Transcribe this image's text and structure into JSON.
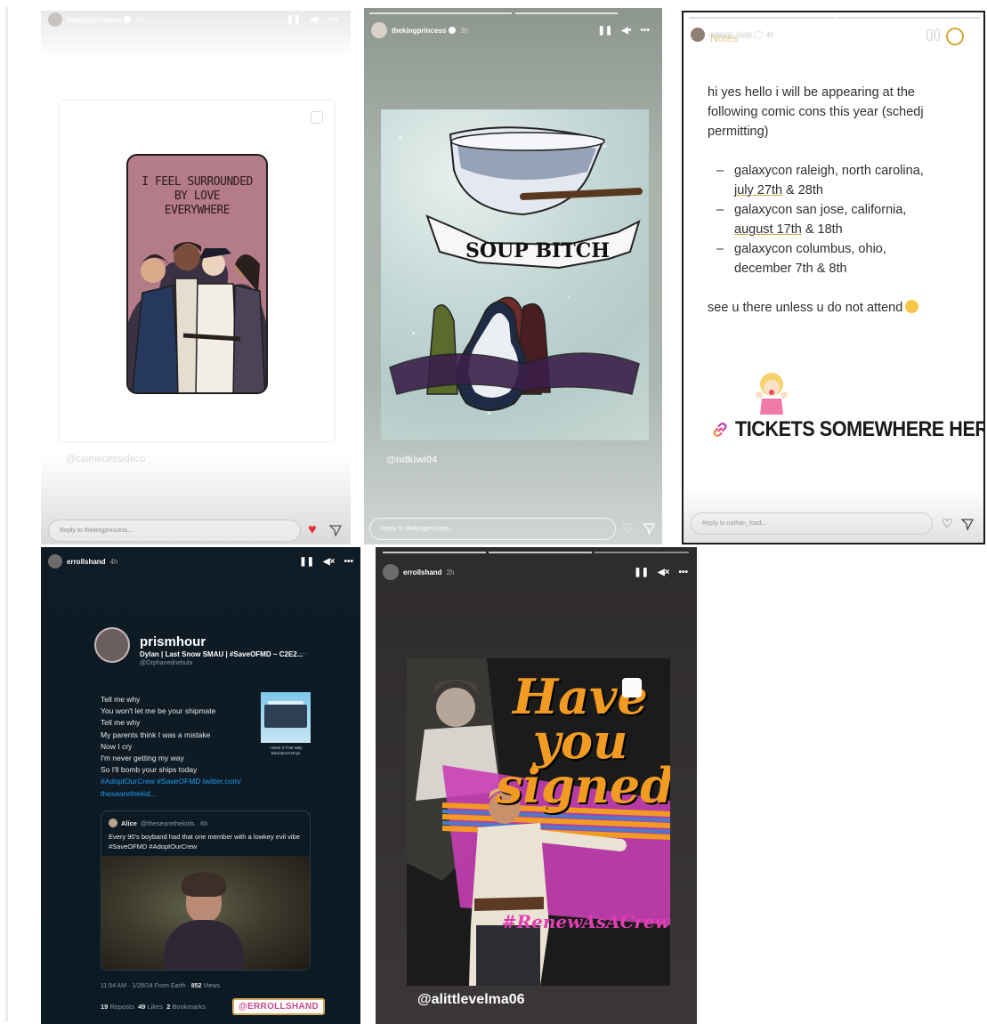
{
  "story1": {
    "user": "thekingprincess",
    "time": "3h",
    "sticker_lines": [
      "I FEEL SURROUNDED",
      "BY LOVE",
      "EVERYWHERE"
    ],
    "watermark": "@caimecessideco",
    "reply_placeholder": "Reply to thekingprincess...",
    "colors": {
      "heart": "#ed2a3c",
      "sticker_bg": "#b47b88"
    }
  },
  "story2": {
    "user": "thekingprincess",
    "time": "3h",
    "banner_text": "SOUP BITCH",
    "handle": "@ndkiwi04",
    "reply_placeholder": "Reply to thekingprincess..."
  },
  "story3": {
    "user": "nathan_foad",
    "time": "4h",
    "notes_title": "Notes",
    "intro": "hi yes hello i will be appearing at the following comic cons this year (schedj permitting)",
    "cons": [
      {
        "place": "galaxycon raleigh, north carolina,",
        "date_u": "july 27th",
        "date_rest": " & 28th"
      },
      {
        "place": "galaxycon san jose, california,",
        "date_u": "august 17th",
        "date_rest": " & 18th"
      },
      {
        "place": "galaxycon columbus, ohio,",
        "date_u": "",
        "date_rest": "december 7th & 8th"
      }
    ],
    "sign_off": "see u there unless u do not attend",
    "link_label": "TICKETS SOMEWHERE HERE",
    "reply_placeholder": "Reply to nathan_foad..."
  },
  "story4": {
    "user": "errollshand",
    "time": "4h",
    "tweet": {
      "display_name": "prismhour",
      "sub_name": "Dylan | Last Snow SMAU | #SaveOFMD ~ C2E2...",
      "at": "@Orphanednebula",
      "more": "···",
      "lyrics": [
        "Tell me why",
        "You won't let me be your shipmate",
        "Tell me why",
        "My parents think I was a mistake",
        "Now I cry",
        "I'm never getting my way",
        "So I'll bomb your ships today"
      ],
      "tags_line1": "#AdoptOurCrew #SaveOFMD twitter.com/",
      "tags_line2": "thesearethekid...",
      "album_caption": "I Want It That Way\nBackstreet Boys",
      "quote_name": "Alice",
      "quote_meta": "@thesearethekids · 6h",
      "quote_text": "Every 90's boyband had that one member with a lowkey evil vibe #SaveOFMD #AdoptOurCrew",
      "time_line": "11:54 AM · 1/28/24 From Earth ·",
      "views": "852",
      "views_label": "Views",
      "reposts": "19",
      "reposts_label": "Reposts",
      "likes": "49",
      "likes_label": "Likes",
      "bookmarks": "2",
      "bookmarks_label": "Bookmarks"
    },
    "mention": "@ERROLLSHAND"
  },
  "story5": {
    "user": "errollshand",
    "time": "2h",
    "poster_title": [
      "Have",
      "you",
      "signed"
    ],
    "hashtag": "#RenewAsACrew",
    "handle": "@alittlevelma06"
  }
}
